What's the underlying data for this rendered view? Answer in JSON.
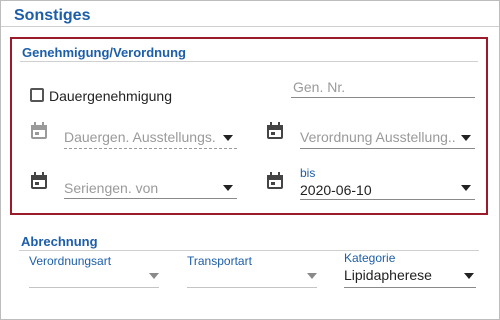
{
  "title": "Sonstiges",
  "genehmigung": {
    "title": "Genehmigung/Verordnung",
    "dauergenehmigung_label": "Dauergenehmigung",
    "dauergenehmigung_checked": false,
    "gen_nr_placeholder": "Gen. Nr.",
    "dauergen_ausstellung_placeholder": "Dauergen. Ausstellungs...",
    "verordnung_ausstellung_placeholder": "Verordnung Ausstellung...",
    "seriengen_von_placeholder": "Seriengen. von",
    "bis_label": "bis",
    "bis_value": "2020-06-10"
  },
  "abrechnung": {
    "title": "Abrechnung",
    "verordnungsart_label": "Verordnungsart",
    "verordnungsart_value": "",
    "transportart_label": "Transportart",
    "transportart_value": "",
    "kategorie_label": "Kategorie",
    "kategorie_value": "Lipidapherese"
  },
  "icons": {
    "date": "calendar-icon",
    "dropdown": "caret-down-icon"
  },
  "colors": {
    "accent": "#1d5ea8",
    "highlight_border": "#9b1b2a"
  }
}
